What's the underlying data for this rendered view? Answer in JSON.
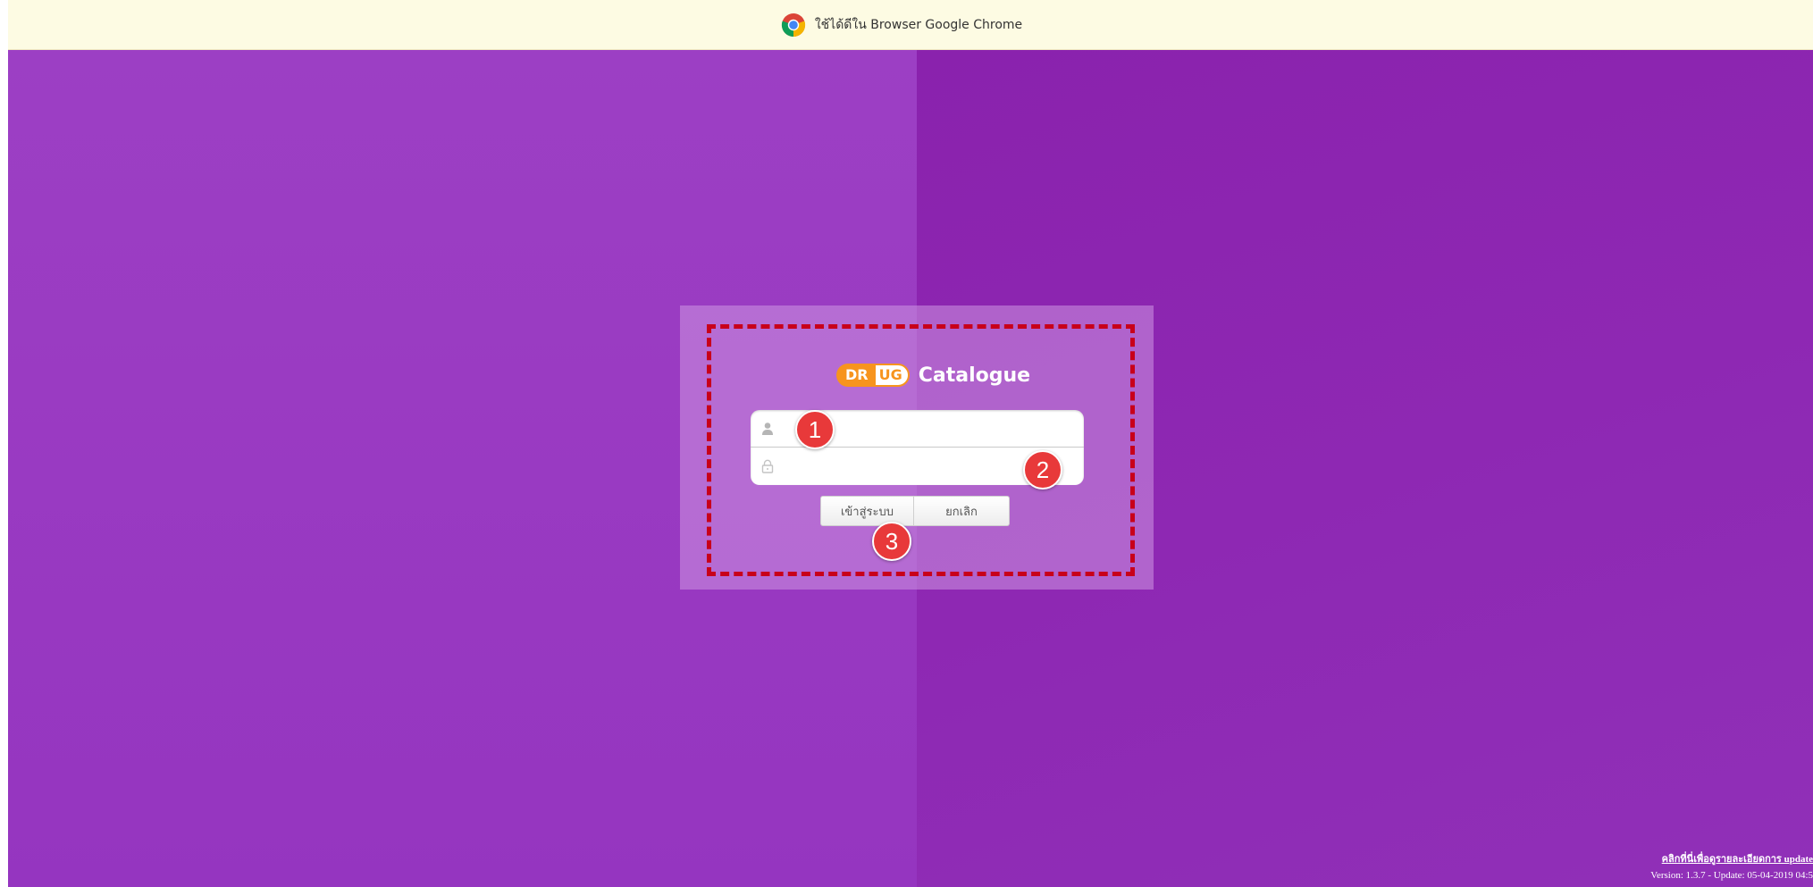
{
  "banner": {
    "icon": "chrome-icon",
    "text": "ใช้ได้ดีใน Browser Google Chrome"
  },
  "logo": {
    "part1": "DR",
    "part2": "UG",
    "part3": "Catalogue"
  },
  "form": {
    "username_icon": "user-icon",
    "password_icon": "lock-icon",
    "username_value": "",
    "password_value": "",
    "login_button": "เข้าสู่ระบบ",
    "cancel_button": "ยกเลิก"
  },
  "markers": {
    "m1": "1",
    "m2": "2",
    "m3": "3"
  },
  "footer": {
    "link_text": "คลิกที่นี่เพื่อดูรายละเอียดการ update",
    "version_text": "Version: 1.3.7 - Update: 05-04-2019 04:5"
  },
  "colors": {
    "background": "#8f27b4",
    "banner_bg": "#fdfbe3",
    "highlight_border": "#c8001a",
    "marker": "#e8393a",
    "logo_orange": "#f7941e"
  }
}
